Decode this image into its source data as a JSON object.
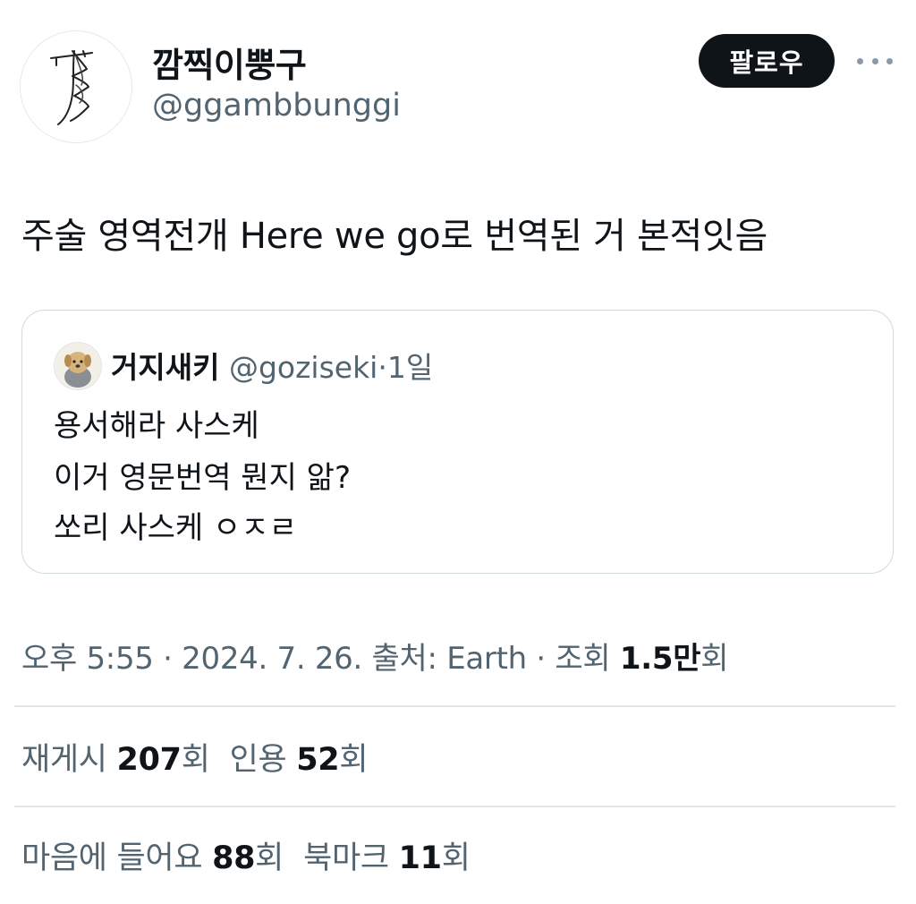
{
  "author": {
    "name": "깜찍이뿡구",
    "handle": "@ggambbunggi",
    "avatar_icon": "scribble-signature-avatar"
  },
  "follow_label": "팔로우",
  "more_icon": "more-options-icon",
  "tweet_text": "주술 영역전개 Here we go로 번역된 거 본적잇음",
  "quote": {
    "name": "거지새키",
    "handle": "@goziseki",
    "dot": "·",
    "time": "1일",
    "avatar_icon": "dog-avatar",
    "lines": [
      "용서해라 사스케",
      "이거 영문번역 뭔지 앎?",
      "쏘리 사스케 ㅇㅈㄹ"
    ]
  },
  "meta": {
    "time": "오후 5:55",
    "sep": " · ",
    "date": "2024. 7. 26.",
    "source_label": "출처:",
    "source": "Earth",
    "views_label": "조회",
    "views_value": "1.5만",
    "views_unit": "회"
  },
  "stats": {
    "retweets_label": "재게시",
    "retweets": "207",
    "quotes_label": "인용",
    "quotes": "52",
    "likes_label": "마음에 들어요",
    "likes": "88",
    "bookmarks_label": "북마크",
    "bookmarks": "11",
    "unit": "회"
  }
}
